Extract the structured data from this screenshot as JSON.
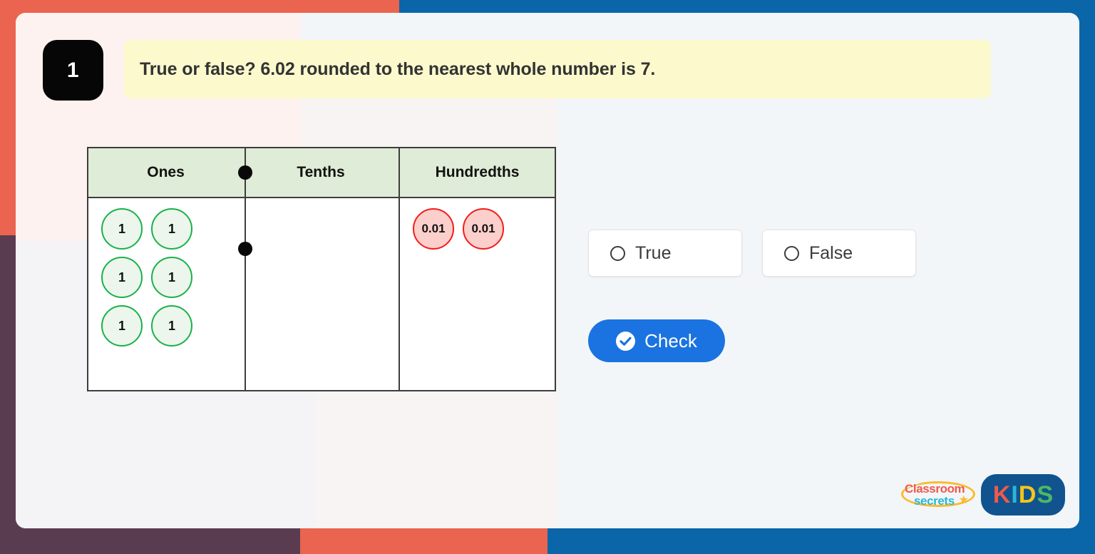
{
  "question": {
    "number": "1",
    "text": "True or false? 6.02 rounded to the nearest whole number is 7."
  },
  "place_value_table": {
    "headers": [
      "Ones",
      "Tenths",
      "Hundredths"
    ],
    "decimal_point": "•",
    "columns": [
      {
        "name": "Ones",
        "counter_label": "1",
        "counter_count": 6
      },
      {
        "name": "Tenths",
        "counter_label": "",
        "counter_count": 0
      },
      {
        "name": "Hundredths",
        "counter_label": "0.01",
        "counter_count": 2
      }
    ]
  },
  "answers": {
    "options": [
      {
        "label": "True",
        "selected": false
      },
      {
        "label": "False",
        "selected": false
      }
    ]
  },
  "actions": {
    "check_label": "Check"
  },
  "branding": {
    "classroom": "Classroom",
    "secrets": "secrets",
    "star": "★",
    "kids": [
      "K",
      "I",
      "D",
      "S"
    ]
  },
  "colors": {
    "frame_blue": "#0a66a8",
    "frame_coral": "#ea6450",
    "frame_purple": "#593c50",
    "banner_yellow": "#fcfacd",
    "table_header_green": "#dfecd7",
    "counter_green": "#18b24a",
    "counter_red": "#f41c1c",
    "check_blue": "#1a73e0"
  }
}
